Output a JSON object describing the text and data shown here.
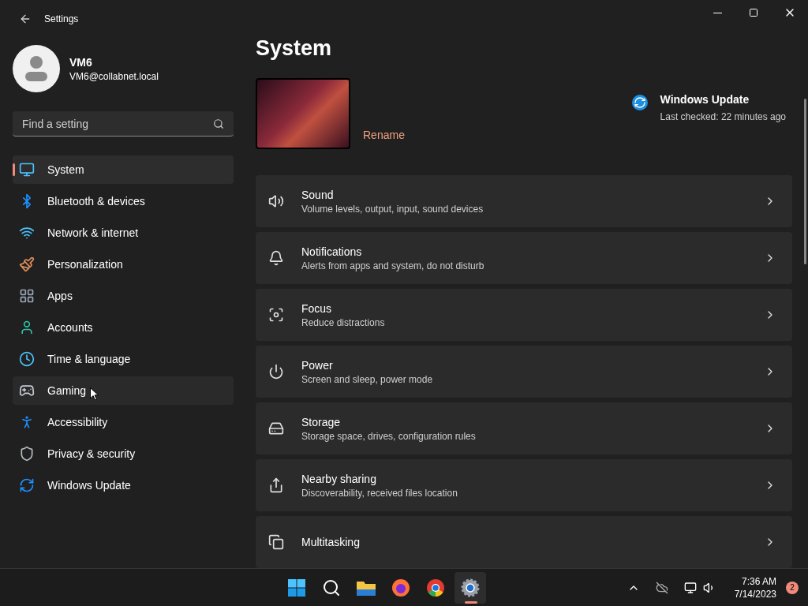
{
  "window": {
    "title": "Settings"
  },
  "account": {
    "name": "VM6",
    "email": "VM6@collabnet.local"
  },
  "search": {
    "placeholder": "Find a setting"
  },
  "sidebar": {
    "items": [
      {
        "label": "System",
        "selected": true,
        "hovered": false
      },
      {
        "label": "Bluetooth & devices",
        "selected": false,
        "hovered": false
      },
      {
        "label": "Network & internet",
        "selected": false,
        "hovered": false
      },
      {
        "label": "Personalization",
        "selected": false,
        "hovered": false
      },
      {
        "label": "Apps",
        "selected": false,
        "hovered": false
      },
      {
        "label": "Accounts",
        "selected": false,
        "hovered": false
      },
      {
        "label": "Time & language",
        "selected": false,
        "hovered": false
      },
      {
        "label": "Gaming",
        "selected": false,
        "hovered": true
      },
      {
        "label": "Accessibility",
        "selected": false,
        "hovered": false
      },
      {
        "label": "Privacy & security",
        "selected": false,
        "hovered": false
      },
      {
        "label": "Windows Update",
        "selected": false,
        "hovered": false
      }
    ]
  },
  "page": {
    "title": "System",
    "rename": "Rename",
    "update": {
      "title": "Windows Update",
      "status": "Last checked: 22 minutes ago"
    }
  },
  "settings": [
    {
      "kind": "sound",
      "title": "Sound",
      "subtitle": "Volume levels, output, input, sound devices"
    },
    {
      "kind": "notifications",
      "title": "Notifications",
      "subtitle": "Alerts from apps and system, do not disturb"
    },
    {
      "kind": "focus",
      "title": "Focus",
      "subtitle": "Reduce distractions"
    },
    {
      "kind": "power",
      "title": "Power",
      "subtitle": "Screen and sleep, power mode"
    },
    {
      "kind": "storage",
      "title": "Storage",
      "subtitle": "Storage space, drives, configuration rules"
    },
    {
      "kind": "sharing",
      "title": "Nearby sharing",
      "subtitle": "Discoverability, received files location"
    },
    {
      "kind": "multitasking",
      "title": "Multitasking"
    }
  ],
  "taskbar": {
    "apps": [
      {
        "kind": "start",
        "selected": false
      },
      {
        "kind": "search",
        "selected": false
      },
      {
        "kind": "files",
        "selected": false
      },
      {
        "kind": "firefox",
        "selected": false
      },
      {
        "kind": "chrome",
        "selected": false
      },
      {
        "kind": "settings",
        "selected": true
      }
    ],
    "time": "7:36 AM",
    "date": "7/14/2023",
    "badge": "2"
  }
}
